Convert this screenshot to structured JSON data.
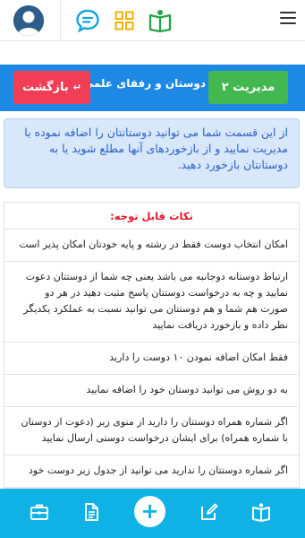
{
  "topbar": {
    "icons": [
      "avatar-icon",
      "chat-icon",
      "grid-icon",
      "book-icon",
      "menu-icon"
    ]
  },
  "header": {
    "manage_label": "مدیریت ۲",
    "title": "دوستان و رفقای علمی",
    "back_label": "بازگشت"
  },
  "info": {
    "text": "از این قسمت شما می توانید دوستانتان را اضافه نموده یا مدیریت نمایید و از بازخوردهای آنها مطلع شوید یا به دوستانتان بازخورد دهید."
  },
  "notes": {
    "title": "نکات قابل توجه:",
    "items": [
      "امکان انتخاب دوست فقط در رشته و پایه خودتان امکان پذیر است",
      "ارتباط دوستانه دوجانبه می باشد یعنی چه شما از دوستتان دعوت نمایید و چه به درخواست دوستتان پاسخ مثبت دهید در هر دو صورت هم شما و هم دوستتان می توانید نسبت به عملکرد یکدیگر نظر داده و بازخورد دریافت نمایید",
      "فقط امکان اضافه نمودن ۱۰ دوست را دارید",
      "به دو روش می توانید دوستان خود را اضافه نمایید",
      "اگر شماره همراه دوستتان را دارید از منوی زیر (دعوت از دوستان با شماره همراه) برای ایشان درخواست دوستی ارسال نمایید",
      "اگر شماره دوستتان را ندارید می توانید از جدول زیر دوست خود"
    ]
  },
  "bottom_nav": {
    "add_label": "+",
    "icons": [
      "briefcase-icon",
      "document-icon",
      "add-icon",
      "edit-icon",
      "open-book-icon"
    ]
  },
  "colors": {
    "header_blue": "#1e88e5",
    "manage_green": "#43b750",
    "back_red": "#ef3e55",
    "info_bg": "#d9e7fb",
    "info_text": "#2962c7",
    "notes_title": "#e0182d",
    "bottom_bar": "#10b2e6"
  }
}
